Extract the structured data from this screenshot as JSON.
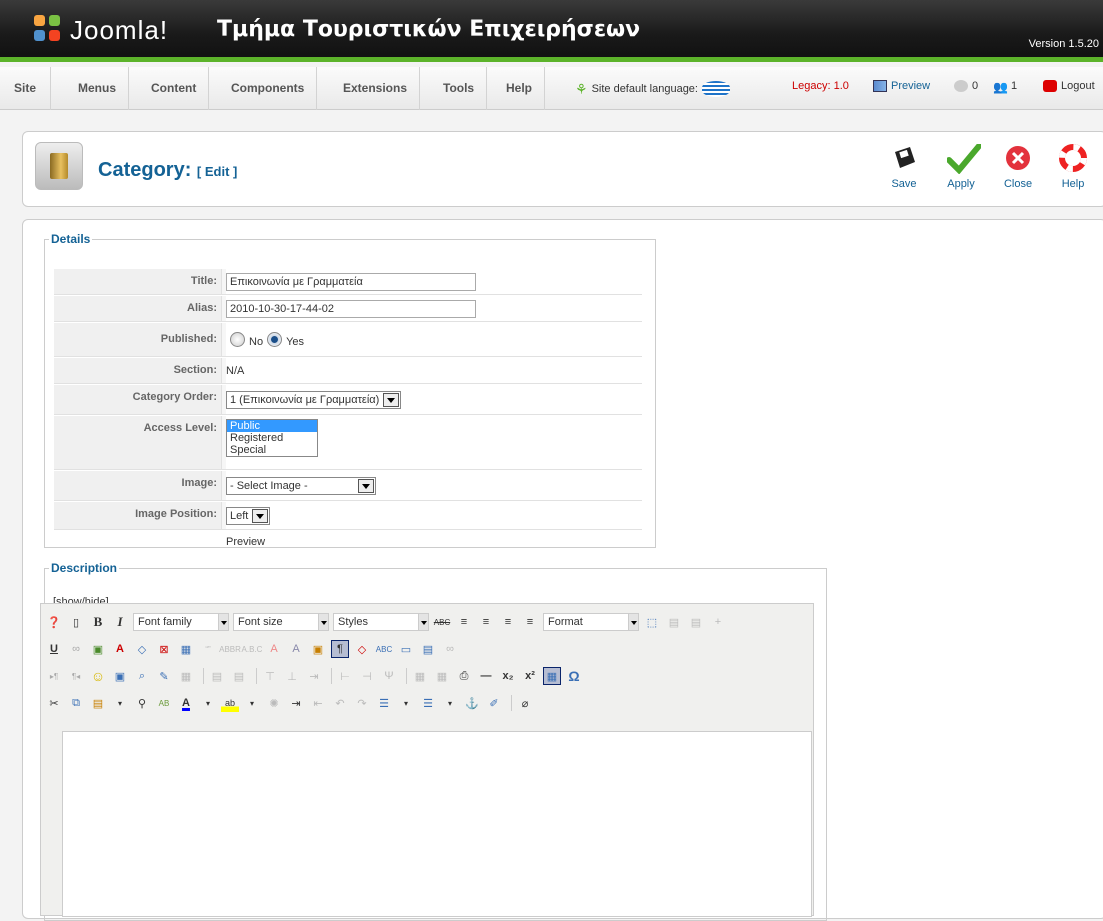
{
  "header": {
    "logo_text": "Joomla!",
    "site_name": "Τμήμα Τουριστικών Επιχειρήσεων",
    "version": "Version 1.5.20"
  },
  "menu": {
    "items": [
      "Site",
      "Menus",
      "Content",
      "Components",
      "Extensions",
      "Tools",
      "Help"
    ]
  },
  "status": {
    "site_language": "Site default language:",
    "legacy": "Legacy: 1.0",
    "preview": "Preview",
    "messages": "0",
    "users": "1",
    "logout": "Logout"
  },
  "toolbar": {
    "title": "Category:",
    "subtitle": "[ Edit ]",
    "save": "Save",
    "apply": "Apply",
    "close": "Close",
    "help": "Help"
  },
  "details": {
    "legend": "Details",
    "title_label": "Title:",
    "title_value": "Επικοινωνία με Γραμματεία",
    "alias_label": "Alias:",
    "alias_value": "2010-10-30-17-44-02",
    "published_label": "Published:",
    "published_no": "No",
    "published_yes": "Yes",
    "section_label": "Section:",
    "section_value": "N/A",
    "order_label": "Category Order:",
    "order_value": "1 (Επικοινωνία με Γραμματεία)",
    "access_label": "Access Level:",
    "access_options": [
      "Public",
      "Registered",
      "Special"
    ],
    "image_label": "Image:",
    "image_value": "- Select Image -",
    "imagepos_label": "Image Position:",
    "imagepos_value": "Left",
    "preview": "Preview"
  },
  "description": {
    "legend": "Description",
    "toggle": "[show/hide]",
    "font_family": "Font family",
    "font_size": "Font size",
    "styles": "Styles",
    "format": "Format"
  }
}
